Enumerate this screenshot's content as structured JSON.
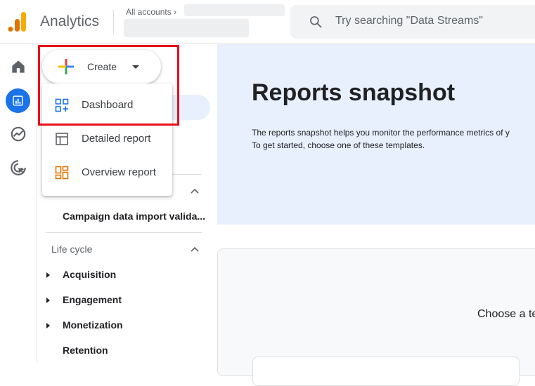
{
  "header": {
    "app_title": "Analytics",
    "accounts_label": "All accounts",
    "search_placeholder": "Try searching \"Data Streams\""
  },
  "rail": {
    "items": [
      {
        "icon": "home-icon"
      },
      {
        "icon": "reports-icon",
        "active": true
      },
      {
        "icon": "explore-icon"
      },
      {
        "icon": "advertising-icon"
      }
    ]
  },
  "create": {
    "label": "Create",
    "menu": [
      {
        "label": "Dashboard",
        "icon": "dashboard-icon"
      },
      {
        "label": "Detailed report",
        "icon": "detailed-report-icon"
      },
      {
        "label": "Overview report",
        "icon": "overview-report-icon"
      }
    ]
  },
  "nav": {
    "campaign_item": "Campaign data import valida...",
    "lifecycle_label": "Life cycle",
    "lifecycle_items": [
      "Acquisition",
      "Engagement",
      "Monetization",
      "Retention"
    ]
  },
  "main": {
    "title": "Reports snapshot",
    "desc_line1": "The reports snapshot helps you monitor the performance metrics of y",
    "desc_line2": "To get started, choose one of these templates.",
    "card_title": "Choose a te"
  },
  "colors": {
    "accent": "#1a73e8",
    "highlight": "#e8101a",
    "hero_bg": "#e8f0fe"
  }
}
